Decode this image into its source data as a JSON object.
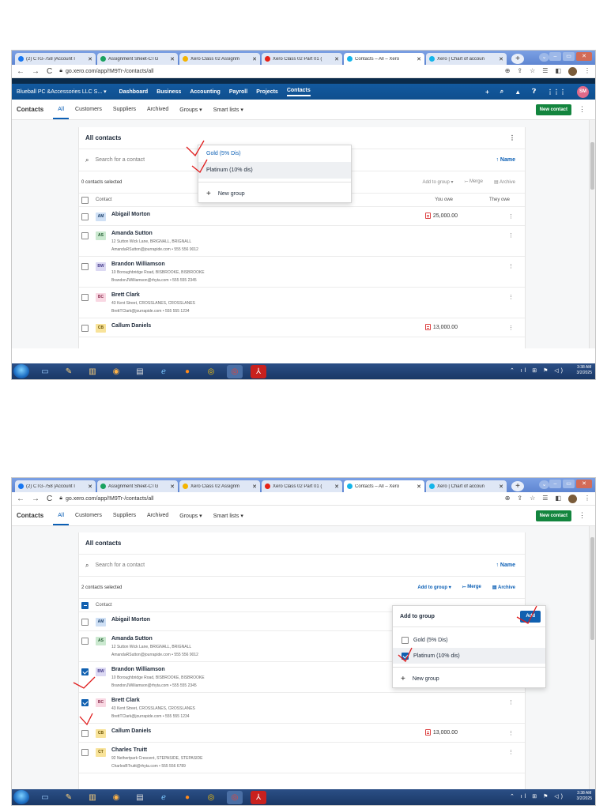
{
  "browser": {
    "tabs": [
      {
        "label": "(2) CTG-758 |Account I",
        "fav": "#1877f2",
        "active": false
      },
      {
        "label": "Assignment Sheet-CTG",
        "fav": "#1aa260",
        "active": false
      },
      {
        "label": "Xero Class 02 Assignm",
        "fav": "#f4b400",
        "active": false
      },
      {
        "label": "Xero Class 02 Part 01 (",
        "fav": "#e62117",
        "active": false
      },
      {
        "label": "Contacts – All – Xero",
        "fav": "#13b5ea",
        "active": true
      },
      {
        "label": "Xero | Chart of accoun",
        "fav": "#13b5ea",
        "active": false
      }
    ],
    "url": "go.xero.com/app/!M9Tr-/contacts/all",
    "new_tab": "+"
  },
  "xero": {
    "org": "Blueball PC &Accessories LLC S...",
    "nav": [
      "Dashboard",
      "Business",
      "Accounting",
      "Payroll",
      "Projects",
      "Contacts"
    ],
    "avatar": "SM"
  },
  "subnav": {
    "title": "Contacts",
    "items": [
      "All",
      "Customers",
      "Suppliers",
      "Archived",
      "Groups ▾",
      "Smart lists ▾"
    ],
    "new_contact": "New contact"
  },
  "card": {
    "title": "All contacts",
    "search_placeholder": "Search for a contact",
    "sort": "↑ Name",
    "col_contact": "Contact",
    "col_you_owe": "You owe",
    "col_they_owe": "They owe",
    "actions": {
      "add_to_group": "Add to group ▾",
      "merge": "⤚ Merge",
      "archive": "▤ Archive"
    }
  },
  "screen1": {
    "selected_text": "0 contacts selected",
    "groups_menu": [
      "Gold (5% Dis)",
      "Platinum (10% dis)"
    ],
    "new_group": "New group"
  },
  "screen2": {
    "selected_text": "2 contacts selected",
    "add_to_group_title": "Add to group",
    "add_label": "Add",
    "options": [
      {
        "label": "Gold (5% Dis)",
        "checked": false
      },
      {
        "label": "Platinum (10% dis)",
        "checked": true
      }
    ],
    "new_group": "New group"
  },
  "contacts": [
    {
      "initials": "AM",
      "color": "blue",
      "name": "Abigail Morton",
      "address": "",
      "email": "",
      "you_owe": "25,000.00"
    },
    {
      "initials": "AS",
      "color": "green",
      "name": "Amanda Sutton",
      "address": "12 Sutton Wick Lane, BRIGNALL, BRIGNALL",
      "email": "AmandaRSutton@jourrapide.com • 555 556 9012",
      "you_owe": ""
    },
    {
      "initials": "BW",
      "color": "lilac",
      "name": "Brandon Williamson",
      "address": "10 Boroughbridge Road, BISBROOKE, BISBROOKE",
      "email": "BrandonJWilliamson@rhyta.com • 555 555 2345",
      "you_owe": ""
    },
    {
      "initials": "BC",
      "color": "pink",
      "name": "Brett Clark",
      "address": "43 Kent Street, CROSSLANES, CROSSLANES",
      "email": "BrettTClark@jourrapide.com • 555 555 1234",
      "you_owe": ""
    },
    {
      "initials": "CB",
      "color": "yellow",
      "name": "Callum Daniels",
      "address": "",
      "email": "",
      "you_owe": "13,000.00"
    },
    {
      "initials": "CT",
      "color": "yellow",
      "name": "Charles Truitt",
      "address": "92 Nethertpark Crescent, STEPASIDE, STEPASIDE",
      "email": "CharlesBTruitt@rhyta.com • 555 556 6789",
      "you_owe": ""
    }
  ],
  "taskbar": {
    "time": "3:38 AM",
    "date": "3/2/2025"
  },
  "colors": {
    "xero_blue": "#0e4d8c",
    "accent_link": "#0b5fb5",
    "new_contact_green": "#13853e",
    "pen_mark_red": "#e01b1b"
  }
}
